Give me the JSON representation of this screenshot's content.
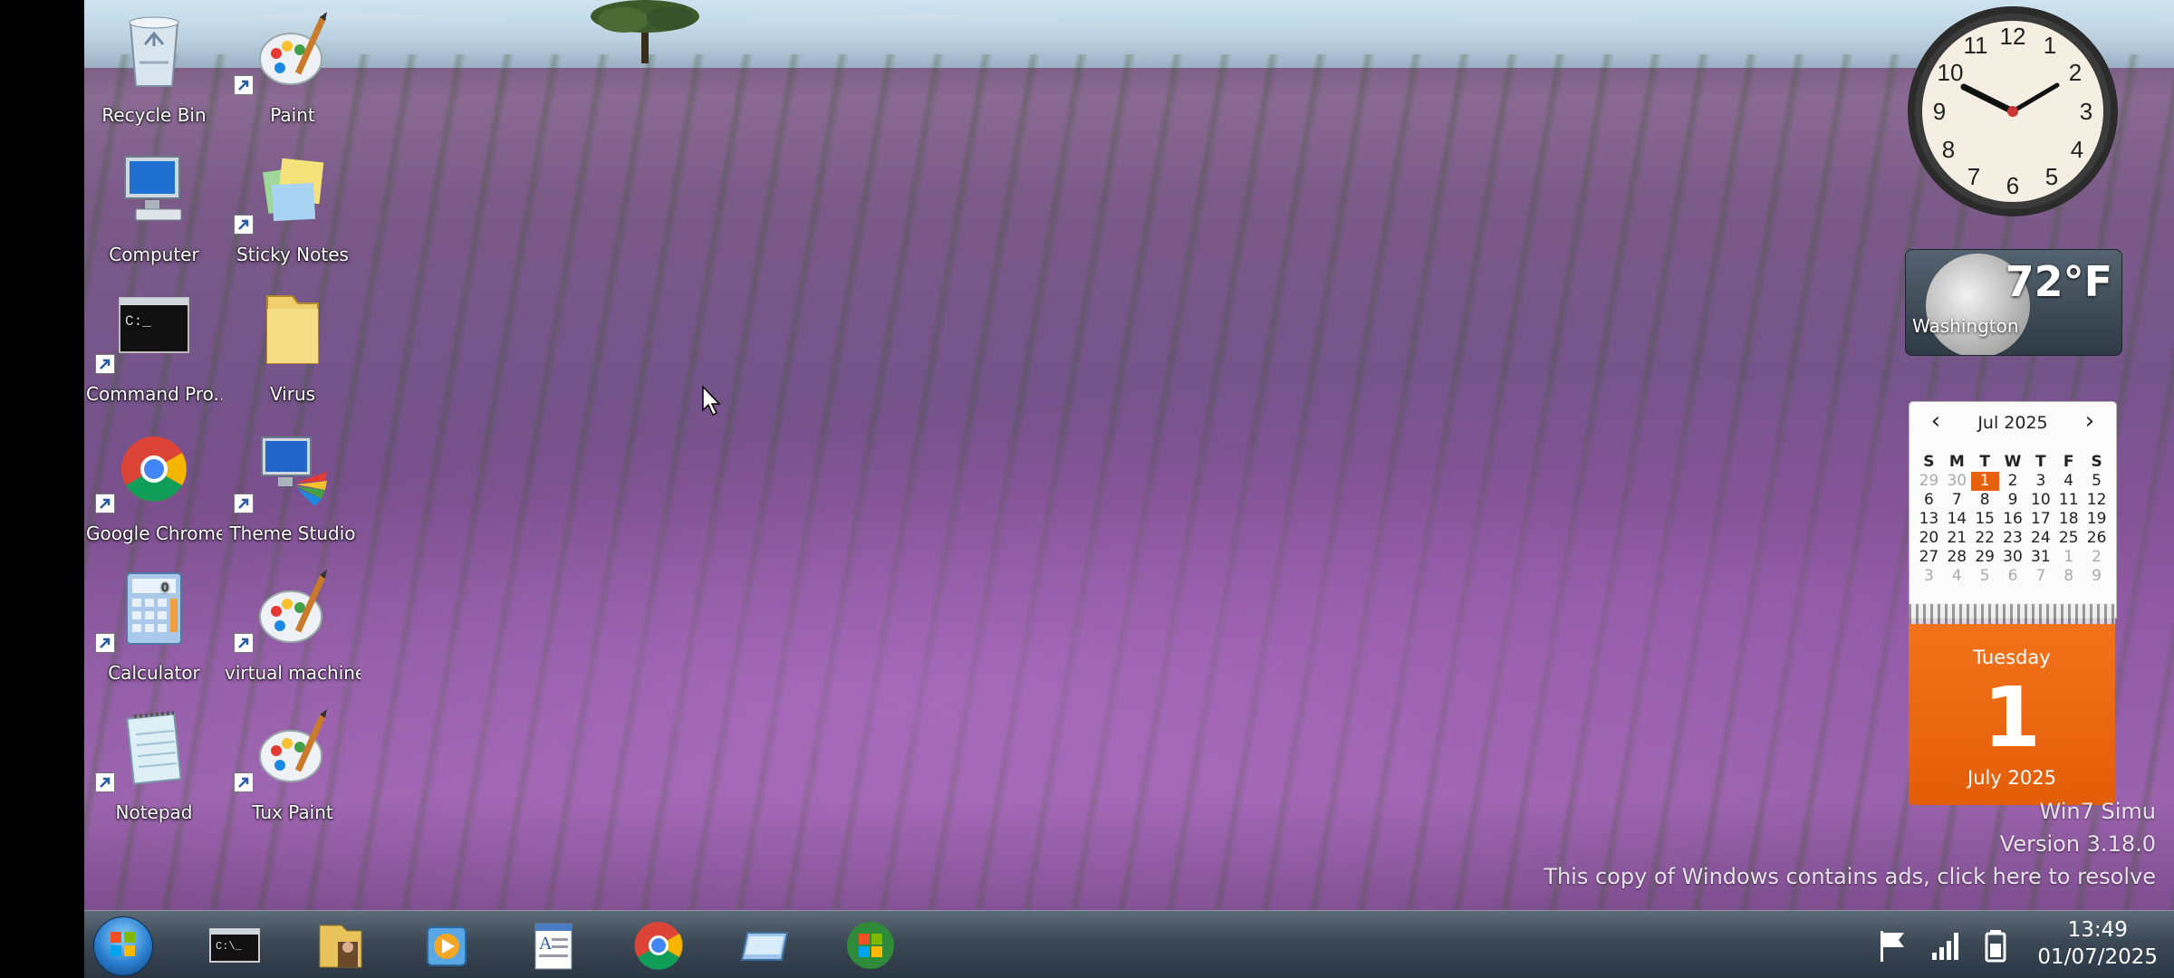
{
  "desktop_icons": [
    {
      "label": "Recycle Bin",
      "icon": "recycle-bin-icon"
    },
    {
      "label": "Paint",
      "icon": "paint-icon"
    },
    {
      "label": "Computer",
      "icon": "computer-icon"
    },
    {
      "label": "Sticky Notes",
      "icon": "sticky-notes-icon"
    },
    {
      "label": "Command Pro...",
      "icon": "command-prompt-icon"
    },
    {
      "label": "Virus",
      "icon": "folder-icon"
    },
    {
      "label": "Google Chrome",
      "icon": "chrome-icon"
    },
    {
      "label": "Theme Studio",
      "icon": "theme-studio-icon"
    },
    {
      "label": "Calculator",
      "icon": "calculator-icon"
    },
    {
      "label": "virtual machine",
      "icon": "paint-icon"
    },
    {
      "label": "Notepad",
      "icon": "notepad-icon"
    },
    {
      "label": "Tux Paint",
      "icon": "paint-icon"
    }
  ],
  "weather": {
    "temp": "72°F",
    "city": "Washington"
  },
  "calendar": {
    "month_label": "Jul 2025",
    "dow": [
      "S",
      "M",
      "T",
      "W",
      "T",
      "F",
      "S"
    ],
    "days": [
      "29",
      "30",
      "1",
      "2",
      "3",
      "4",
      "5",
      "6",
      "7",
      "8",
      "9",
      "10",
      "11",
      "12",
      "13",
      "14",
      "15",
      "16",
      "17",
      "18",
      "19",
      "20",
      "21",
      "22",
      "23",
      "24",
      "25",
      "26",
      "27",
      "28",
      "29",
      "30",
      "31",
      "1",
      "2",
      "3",
      "4",
      "5",
      "6",
      "7",
      "8",
      "9"
    ],
    "today_index": 2,
    "muted_leading": 2,
    "muted_trailing_start": 33,
    "weekday": "Tuesday",
    "day": "1",
    "month_year": "July 2025"
  },
  "watermark": {
    "line1": "Win7 Simu",
    "line2": "Version 3.18.0",
    "line3": "This copy of Windows contains ads, click here to resolve"
  },
  "taskbar": {
    "items": [
      "start-orb-icon",
      "command-prompt-icon",
      "file-explorer-icon",
      "media-player-icon",
      "wordpad-icon",
      "chrome-icon",
      "screen-icon",
      "windows-update-icon"
    ],
    "tray": {
      "time": "13:49",
      "date": "01/07/2025"
    }
  },
  "colors": {
    "accent": "#e7610c",
    "taskbar": "#3b4855"
  }
}
